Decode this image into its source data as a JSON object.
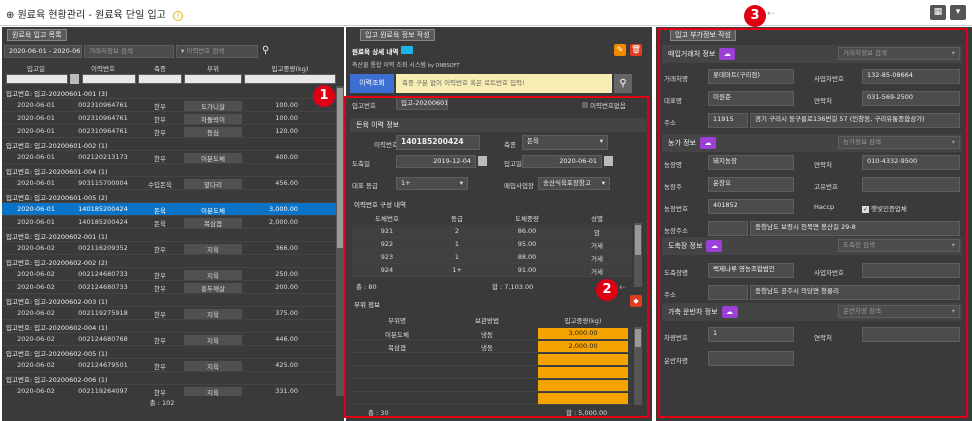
{
  "title": {
    "text": "원료육 현황관리 - 원료육 단일 입고",
    "back_glyph": "⊕",
    "warn_glyph": "!"
  },
  "left": {
    "panel_title": "원료육 입고 목록",
    "date_range": "2020-06-01 - 2020-06-30",
    "search_placeholder": "거래처정보 검색",
    "history_search": "이력번호 검색",
    "cols": [
      "입고일",
      "이력번호",
      "축종",
      "부위",
      "입고중량(kg)"
    ],
    "rows": [
      {
        "g": "입고번호: 입고-20200601-001 (3)"
      },
      {
        "c": [
          "2020-06-01",
          "002310964761",
          "한우",
          "도가니살",
          "100.00"
        ]
      },
      {
        "c": [
          "2020-06-01",
          "002310964761",
          "한우",
          "차돌박이",
          "100.00"
        ]
      },
      {
        "c": [
          "2020-06-01",
          "002310964761",
          "한우",
          "등심",
          "120.00"
        ]
      },
      {
        "g": "입고번호: 입고-20200601-002 (1)"
      },
      {
        "c": [
          "2020-06-01",
          "002120213173",
          "한우",
          "이분도체",
          "400.00"
        ]
      },
      {
        "g": "입고번호: 입고-20200601-004 (1)"
      },
      {
        "c": [
          "2020-06-01",
          "903115700004",
          "수입돈육",
          "앞다리",
          "456.00"
        ]
      },
      {
        "g": "입고번호: 입고-20200601-005 (2)"
      },
      {
        "c": [
          "2020-06-01",
          "140185200424",
          "돈육",
          "이분도체",
          "3,000.00"
        ],
        "sel": true
      },
      {
        "c": [
          "2020-06-01",
          "140185200424",
          "돈육",
          "목삼겹",
          "2,000.00"
        ]
      },
      {
        "g": "입고번호: 입고-20200602-001 (1)"
      },
      {
        "c": [
          "2020-06-02",
          "002116209352",
          "한우",
          "지육",
          "366.00"
        ]
      },
      {
        "g": "입고번호: 입고-20200602-002 (2)"
      },
      {
        "c": [
          "2020-06-02",
          "002124680733",
          "한우",
          "지육",
          "250.00"
        ]
      },
      {
        "c": [
          "2020-06-02",
          "002124680733",
          "한우",
          "홍두깨살",
          "200.00"
        ]
      },
      {
        "g": "입고번호: 입고-20200602-003 (1)"
      },
      {
        "c": [
          "2020-06-02",
          "002119275918",
          "한우",
          "지육",
          "375.00"
        ]
      },
      {
        "g": "입고번호: 입고-20200602-004 (1)"
      },
      {
        "c": [
          "2020-06-02",
          "002124680768",
          "한우",
          "지육",
          "446.00"
        ]
      },
      {
        "g": "입고번호: 입고-20200602-005 (1)"
      },
      {
        "c": [
          "2020-06-02",
          "002124679501",
          "한우",
          "지육",
          "425.00"
        ]
      },
      {
        "g": "입고번호: 입고-20200602-006 (1)"
      },
      {
        "c": [
          "2020-06-02",
          "002119264097",
          "한우",
          "지육",
          "331.00"
        ]
      }
    ],
    "total": "총 : 102"
  },
  "mid": {
    "panel_title": "입고 원료육 정보 작성",
    "system_title": "원료육 상세 내역",
    "system_sub": "축산물 통합 이력 조회 시스템",
    "by": "by DNBSOFT",
    "history_btn": "이력조회",
    "history_placeholder": "축종 구분 없이 이력번호 혹은 로트번호 입력!",
    "receipt_no_label": "입고번호",
    "receipt_no": "입고-20200601",
    "no_history": "이력번호없음",
    "section1": "돈육 이력 정보",
    "hist_no_label": "이력번호",
    "hist_no": "140185200424",
    "species_label": "축종",
    "species": "돈육",
    "slaughter_label": "도축일",
    "slaughter": "2019-12-04",
    "in_date_label": "입고일",
    "in_date": "2020-06-01",
    "grade_label": "대표 등급",
    "grade": "1+",
    "supplier_label": "매입사업장",
    "supplier": "송산식육포장창고",
    "section2": "이력번호 구성 내역",
    "cols2": [
      "도체번호",
      "등급",
      "도체중량",
      "성별"
    ],
    "rows2": [
      [
        "921",
        "2",
        "86.00",
        "암"
      ],
      [
        "922",
        "1",
        "95.00",
        "거세"
      ],
      [
        "923",
        "1",
        "88.00",
        "거세"
      ],
      [
        "924",
        "1+",
        "91.00",
        "거세"
      ]
    ],
    "total2_left": "총 : 80",
    "total2_right": "합 : 7,103.00",
    "section3": "부위 정보",
    "cols3": [
      "부위명",
      "보관방법",
      "입고중량(kg)"
    ],
    "rows3": [
      [
        "이분도체",
        "냉동",
        "3,000.00"
      ],
      [
        "목삼겹",
        "냉동",
        "2,000.00"
      ]
    ],
    "total3_left": "총 : 30",
    "total3_right": "합 : 5,000.00"
  },
  "right": {
    "panel_title": "입고 부가정보 작성",
    "buyer_label": "매입거래처 정보",
    "buyer_search": "거래처정보 검색",
    "b_name_l": "거래처명",
    "b_name": "롯데마트(구리점)",
    "b_biz_l": "사업자번호",
    "b_biz": "132-85-08664",
    "b_rep_l": "대표명",
    "b_rep": "이원준",
    "b_tel_l": "연락처",
    "b_tel": "031-569-2500",
    "b_addr_l": "주소",
    "b_zip": "11915",
    "b_addr": "경기 구리시 동구릉로136번길 57 (인창동, 구리유통종합상가)",
    "farm_label": "농가 정보",
    "farm_search": "농가정보 검색",
    "f_name_l": "농장명",
    "f_name": "돼지농장",
    "f_tel_l": "연락처",
    "f_tel": "010-4332-9500",
    "f_owner_l": "농장주",
    "f_owner": "윤장오",
    "f_uniq_l": "고유번호",
    "f_uniq": "",
    "f_no_l": "농장번호",
    "f_no": "401852",
    "f_haccp_l": "Haccp",
    "f_haccp": "햇빛인증업체",
    "f_addr_l": "농장주소",
    "f_addr": "충청남도 보령시 천북면 봉산길 29-8",
    "slt_label": "도축장 정보",
    "slt_search": "도축장 검색",
    "s_name_l": "도축장명",
    "s_name": "백제나루 영농조합법인",
    "s_biz_l": "사업자번호",
    "s_biz": "",
    "s_addr_l": "주소",
    "s_addr": "충청남도 공주시 의당면 청룡리",
    "car_label": "가축 운반차 정보",
    "car_search": "운반차량 검색",
    "c_no_l": "차량번호",
    "c_no": "1",
    "c_tel_l": "연락처",
    "c_tel": "",
    "c_drv_l": "운반차명",
    "c_drv": ""
  },
  "badges": [
    "1",
    "2",
    "3"
  ],
  "colors": {
    "highlight": "#e00014",
    "selected": "#0b73c6",
    "orange": "#f5a300",
    "purple": "#9b3fd6",
    "edit": "#f08a00",
    "delete": "#e03c1e"
  }
}
